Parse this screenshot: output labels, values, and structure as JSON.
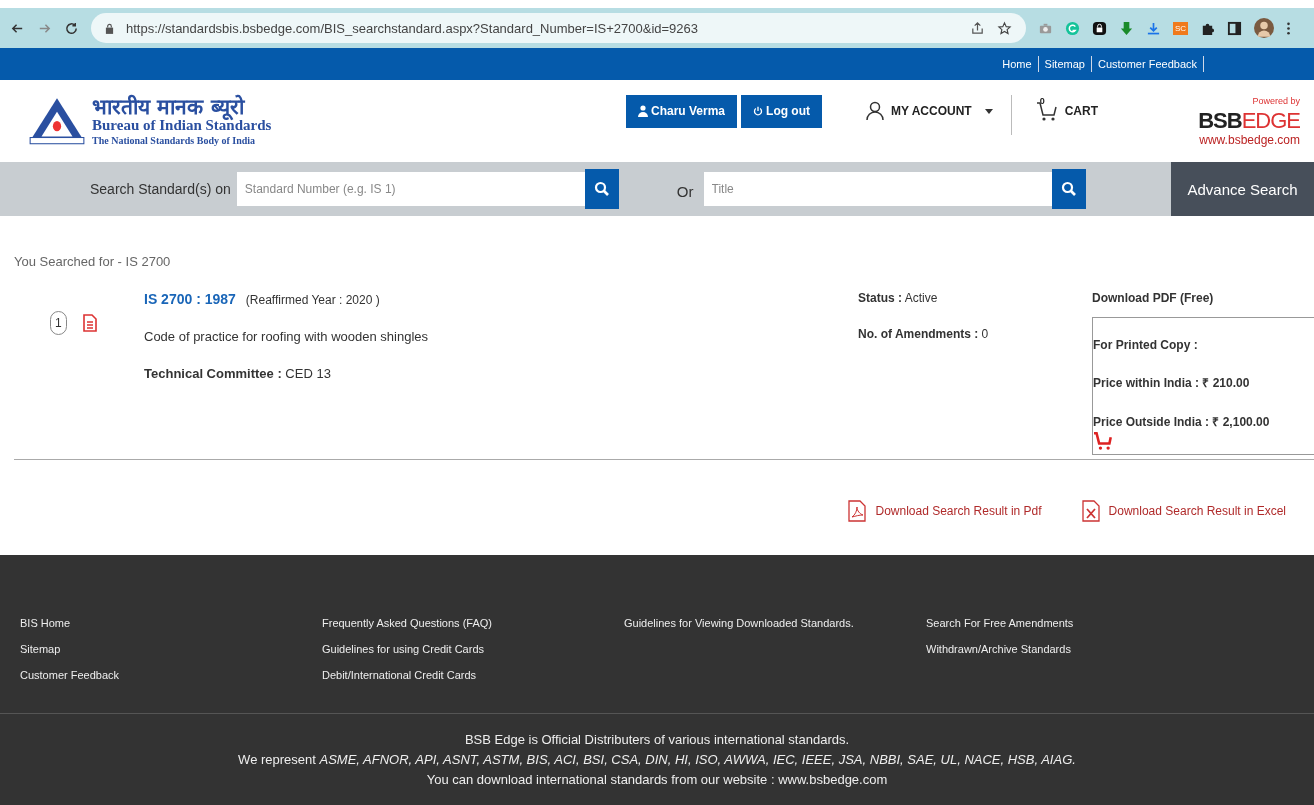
{
  "browser": {
    "url": "https://standardsbis.bsbedge.com/BIS_searchstandard.aspx?Standard_Number=IS+2700&id=9263",
    "extension_badge": "SC"
  },
  "top_links": [
    "Home",
    "Sitemap",
    "Customer Feedback"
  ],
  "logo": {
    "hindi": "भारतीय मानक ब्यूरो",
    "name": "Bureau of Indian Standards",
    "tagline": "The National Standards Body of India"
  },
  "user_buttons": [
    {
      "label": "Charu Verma",
      "kind": "user"
    },
    {
      "label": "Log out",
      "kind": "power"
    }
  ],
  "account": {
    "label": "MY ACCOUNT"
  },
  "cart": {
    "label": "CART",
    "count": "0"
  },
  "brand": {
    "powered": "Powered by",
    "name_dark": "BSB",
    "name_light": "EDGE",
    "site": "www.bsbedge.com"
  },
  "search": {
    "label": "Search Standard(s) on",
    "number_placeholder": "Standard Number (e.g. IS 1)",
    "or": "Or",
    "title_placeholder": "Title",
    "advance": "Advance Search"
  },
  "searched_for": "You Searched for - IS 2700",
  "results": [
    {
      "index": "1",
      "number": "IS 2700 : 1987",
      "reaffirmed": "(Reaffirmed Year : 2020 )",
      "title": "Code of practice for roofing with wooden shingles",
      "committee_label": "Technical Committee :",
      "committee": "CED 13",
      "status_label": "Status :",
      "status": "Active",
      "amendments_label": "No. of Amendments :",
      "amendments": "0",
      "download": "Download PDF (Free)",
      "printed": "For Printed Copy :",
      "price_in_label": "Price within India :",
      "price_in": "₹ 210.00",
      "price_out_label": "Price Outside India :",
      "price_out": "₹ 2,100.00"
    }
  ],
  "downloads": [
    {
      "label": "Download Search Result in Pdf",
      "kind": "pdf"
    },
    {
      "label": "Download Search Result in Excel",
      "kind": "excel"
    }
  ],
  "footer_columns": [
    [
      "BIS Home",
      "Sitemap",
      "Customer Feedback"
    ],
    [
      "Frequently Asked Questions (FAQ)",
      "Guidelines for using Credit Cards",
      "Debit/International Credit Cards"
    ],
    [
      "Guidelines for Viewing Downloaded Standards."
    ],
    [
      "Search For Free Amendments",
      "Withdrawn/Archive Standards"
    ]
  ],
  "bottom_lines": [
    "BSB Edge is Official Distributers of various international standards.",
    "We represent *ASME, AFNOR, API, ASNT, ASTM, BIS, ACI, BSI, CSA, DIN, HI, ISO, AWWA, IEC, IEEE, JSA, NBBI, SAE, UL, NACE, HSB, AIAG.*",
    "You can download international standards from our website : www.bsbedge.com"
  ]
}
